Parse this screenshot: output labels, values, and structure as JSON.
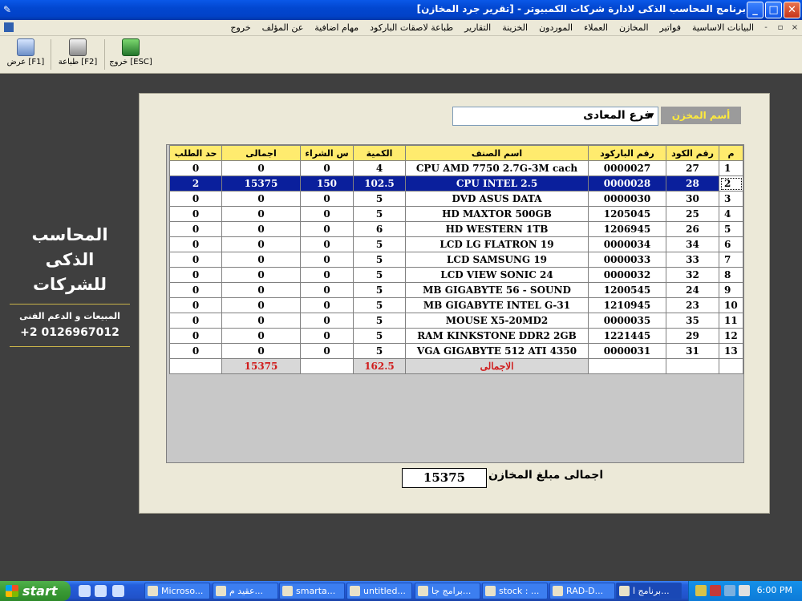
{
  "window": {
    "title": "برنامج المحاسب الذكى لادارة شركات الكمبيوتر - [تقرير جرد المخازن]",
    "controls": [
      "_",
      "□",
      "✕"
    ]
  },
  "menu": {
    "items": [
      "البيانات الاساسية",
      "فواتير",
      "المخازن",
      "العملاء",
      "الموردون",
      "الخزينة",
      "التقارير",
      "طباعة لاصقات الباركود",
      "مهام اضافية",
      "عن المؤلف",
      "خروج"
    ],
    "mdi_controls": [
      "-",
      "▫",
      "×"
    ]
  },
  "toolbar": {
    "view_label": "عرض [F1]",
    "print_label": "طباعة [F2]",
    "exit_label": "خروج [ESC]"
  },
  "brand": {
    "title_line1": "المحاسب الذكى",
    "title_line2": "للشركات",
    "subtitle": "المبيعات و الدعم الفنى",
    "phone": "+2 0126967012",
    "line_color": "#c9b34a"
  },
  "store": {
    "label": "أسم المخزن",
    "value": "فرع المعادى"
  },
  "table": {
    "headers": [
      "م",
      "رقم الكود",
      "رقم الباركود",
      "اسم الصنف",
      "الكمية",
      "س الشراء",
      "اجمالى",
      "حد الطلب"
    ],
    "rows": [
      [
        "1",
        "27",
        "0000027",
        "CPU AMD 7750 2.7G-3M cach",
        "4",
        "0",
        "0",
        "0"
      ],
      [
        "2",
        "28",
        "0000028",
        "CPU INTEL 2.5",
        "102.5",
        "150",
        "15375",
        "2"
      ],
      [
        "3",
        "30",
        "0000030",
        "DVD ASUS DATA",
        "5",
        "0",
        "0",
        "0"
      ],
      [
        "4",
        "25",
        "1205045",
        "HD MAXTOR 500GB",
        "5",
        "0",
        "0",
        "0"
      ],
      [
        "5",
        "26",
        "1206945",
        "HD WESTERN 1TB",
        "6",
        "0",
        "0",
        "0"
      ],
      [
        "6",
        "34",
        "0000034",
        "LCD LG FLATRON 19",
        "5",
        "0",
        "0",
        "0"
      ],
      [
        "7",
        "33",
        "0000033",
        "LCD SAMSUNG 19",
        "5",
        "0",
        "0",
        "0"
      ],
      [
        "8",
        "32",
        "0000032",
        "LCD VIEW SONIC 24",
        "5",
        "0",
        "0",
        "0"
      ],
      [
        "9",
        "24",
        "1200545",
        "MB GIGABYTE 56 - SOUND",
        "5",
        "0",
        "0",
        "0"
      ],
      [
        "10",
        "23",
        "1210945",
        "MB GIGABYTE INTEL G-31",
        "5",
        "0",
        "0",
        "0"
      ],
      [
        "11",
        "35",
        "0000035",
        "MOUSE X5-20MD2",
        "5",
        "0",
        "0",
        "0"
      ],
      [
        "12",
        "29",
        "1221445",
        "RAM KINKSTONE DDR2 2GB",
        "5",
        "0",
        "0",
        "0"
      ],
      [
        "13",
        "31",
        "0000031",
        "VGA GIGABYTE 512 ATI 4350",
        "5",
        "0",
        "0",
        "0"
      ]
    ],
    "selected_row": 1,
    "totals": {
      "label": "الاجمالى",
      "quantity": "162.5",
      "total": "15375"
    },
    "header_color": "#ffeb6e",
    "selection_color": "#0a1f9c",
    "total_color": "#d01c1c"
  },
  "summary": {
    "label": "اجمالى مبلغ المخازن",
    "value": "15375"
  },
  "taskbar": {
    "start_label": "start",
    "tasks": [
      "Microso...",
      "عقيد م...",
      "smarta...",
      "untitled...",
      "برامج جا...",
      "stock : ...",
      "RAD-D...",
      "برنامج ا..."
    ],
    "clock": "6:00 PM"
  }
}
